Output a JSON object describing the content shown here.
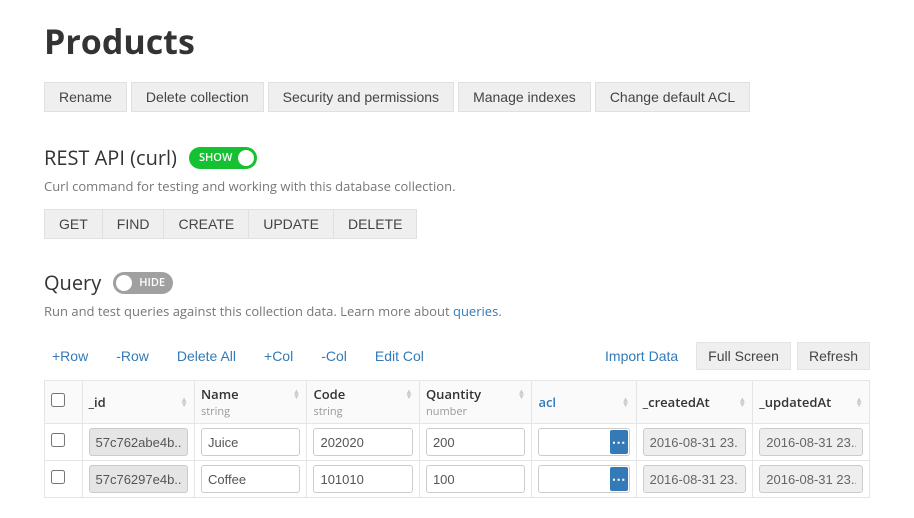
{
  "title": "Products",
  "toolbar": {
    "rename": "Rename",
    "delete_collection": "Delete collection",
    "security": "Security and permissions",
    "manage_indexes": "Manage indexes",
    "change_acl": "Change default ACL"
  },
  "rest_api": {
    "heading": "REST API (curl)",
    "toggle_label": "SHOW",
    "desc": "Curl command for testing and working with this database collection.",
    "buttons": {
      "get": "GET",
      "find": "FIND",
      "create": "CREATE",
      "update": "UPDATE",
      "delete": "DELETE"
    }
  },
  "query": {
    "heading": "Query",
    "toggle_label": "HIDE",
    "desc_prefix": "Run and test queries against this collection data. Learn more about ",
    "desc_link": "queries",
    "desc_suffix": "."
  },
  "actions": {
    "add_row": "+Row",
    "remove_row": "-Row",
    "delete_all": "Delete All",
    "add_col": "+Col",
    "remove_col": "-Col",
    "edit_col": "Edit Col",
    "import_data": "Import Data",
    "full_screen": "Full Screen",
    "refresh": "Refresh"
  },
  "table": {
    "columns": [
      {
        "name": "_id",
        "type": ""
      },
      {
        "name": "Name",
        "type": "string"
      },
      {
        "name": "Code",
        "type": "string"
      },
      {
        "name": "Quantity",
        "type": "number"
      },
      {
        "name": "acl",
        "type": "",
        "link": true
      },
      {
        "name": "_createdAt",
        "type": ""
      },
      {
        "name": "_updatedAt",
        "type": ""
      }
    ],
    "rows": [
      {
        "_id": "57c762abe4b...",
        "Name": "Juice",
        "Code": "202020",
        "Quantity": "200",
        "acl": "",
        "_createdAt": "2016-08-31 23...",
        "_updatedAt": "2016-08-31 23..."
      },
      {
        "_id": "57c76297e4b...",
        "Name": "Coffee",
        "Code": "101010",
        "Quantity": "100",
        "acl": "",
        "_createdAt": "2016-08-31 23...",
        "_updatedAt": "2016-08-31 23..."
      }
    ]
  }
}
